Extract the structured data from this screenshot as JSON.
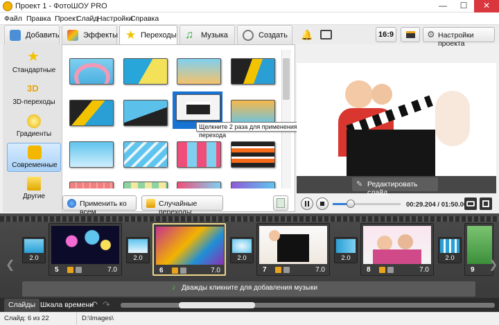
{
  "window": {
    "title": "Проект 1 - ФотоШОУ PRO",
    "controls": {
      "minimize": "—",
      "maximize": "☐",
      "close": "✕"
    }
  },
  "menu": [
    "Файл",
    "Правка",
    "Проект",
    "Слайд",
    "Настройки",
    "Справка"
  ],
  "tabs": [
    {
      "label": "Добавить",
      "icon": "photo-add-icon",
      "color": "#4c8fd6"
    },
    {
      "label": "Эффекты",
      "icon": "palette-icon",
      "color": "#e07b2a"
    },
    {
      "label": "Переходы",
      "icon": "star-icon",
      "color": "#f2c200"
    },
    {
      "label": "Музыка",
      "icon": "music-note-icon",
      "color": "#2cab3a"
    },
    {
      "label": "Создать",
      "icon": "film-reel-icon",
      "color": "#8a8a8a"
    }
  ],
  "right_toolbar": {
    "aspect": "16:9",
    "settings_label": "Настройки проекта"
  },
  "categories": [
    {
      "label": "Стандартные",
      "icon": "star-icon"
    },
    {
      "label": "3D-переходы",
      "icon": "3d-icon"
    },
    {
      "label": "Градиенты",
      "icon": "gradient-icon"
    },
    {
      "label": "Современные",
      "icon": "puzzle-icon"
    },
    {
      "label": "Другие",
      "icon": "box-icon"
    }
  ],
  "selected_category": "Современные",
  "tooltip": "Щелкните 2 раза для применения перехода",
  "buttons": {
    "apply_all": "Применить ко всем",
    "random": "Случайные переходы"
  },
  "preview": {
    "edit_slide": "Редактировать слайд"
  },
  "player": {
    "time": "00:29.204 / 01:50.000",
    "progress": 0.27
  },
  "slides": [
    {
      "num": "5",
      "duration": "7.0"
    },
    {
      "num": "6",
      "duration": "7.0"
    },
    {
      "num": "7",
      "duration": "7.0"
    },
    {
      "num": "8",
      "duration": "7.0"
    },
    {
      "num": "9",
      "duration": ""
    }
  ],
  "transitions": [
    "2.0",
    "2.0",
    "2.0",
    "2.0",
    "2.0"
  ],
  "music_hint": "Дважды кликните для добавления музыки",
  "bottom_tabs": {
    "slides": "Слайды",
    "timeline": "Шкала времени"
  },
  "status": {
    "slide_count": "Слайд: 6 из 22",
    "path": "D:\\Images\\"
  }
}
